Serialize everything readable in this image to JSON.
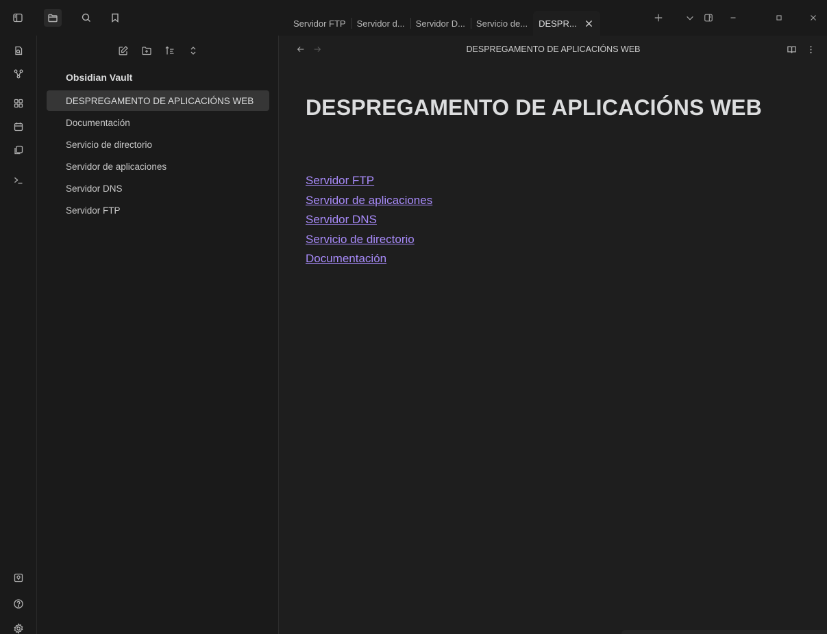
{
  "titlebar": {
    "left_icons": [
      "sidebar-toggle-icon"
    ],
    "sidebar_tabs": [
      "folder-icon",
      "search-icon",
      "bookmark-icon"
    ],
    "tabs": [
      {
        "label": "Servidor FTP",
        "active": false
      },
      {
        "label": "Servidor d...",
        "active": false
      },
      {
        "label": "Servidor D...",
        "active": false
      },
      {
        "label": "Servicio de...",
        "active": false
      },
      {
        "label": "DESPR...",
        "active": true
      }
    ],
    "controls": [
      "plus-icon",
      "chevron-down-icon",
      "right-sidebar-icon",
      "minimize-icon",
      "maximize-icon",
      "close-icon"
    ]
  },
  "ribbon": {
    "top_icons": [
      "open-quick-switcher-icon",
      "graph-view-icon",
      "canvas-icon",
      "daily-note-icon",
      "templates-icon",
      "command-palette-icon"
    ],
    "bottom_icons": [
      "vault-switcher-icon",
      "help-icon",
      "settings-icon"
    ]
  },
  "sidebar": {
    "actions": [
      "new-note-icon",
      "new-folder-icon",
      "sort-icon",
      "collapse-icon"
    ],
    "vault_name": "Obsidian Vault",
    "files": [
      {
        "label": "DESPREGAMENTO DE APLICACIÓNS WEB",
        "active": true
      },
      {
        "label": "Documentación",
        "active": false
      },
      {
        "label": "Servicio de directorio",
        "active": false
      },
      {
        "label": "Servidor de aplicaciones",
        "active": false
      },
      {
        "label": "Servidor DNS",
        "active": false
      },
      {
        "label": "Servidor FTP",
        "active": false
      }
    ]
  },
  "main": {
    "header_title": "DESPREGAMENTO DE APLICACIÓNS WEB",
    "note_title": "DESPREGAMENTO DE APLICACIÓNS WEB",
    "links": [
      "Servidor FTP",
      "Servidor de aplicaciones",
      "Servidor DNS",
      "Servicio de directorio",
      "Documentación"
    ]
  },
  "colors": {
    "background": "#1e1e1e",
    "sidebar": "#1a1a1a",
    "active_file": "#363636",
    "link": "#a88bfa"
  }
}
